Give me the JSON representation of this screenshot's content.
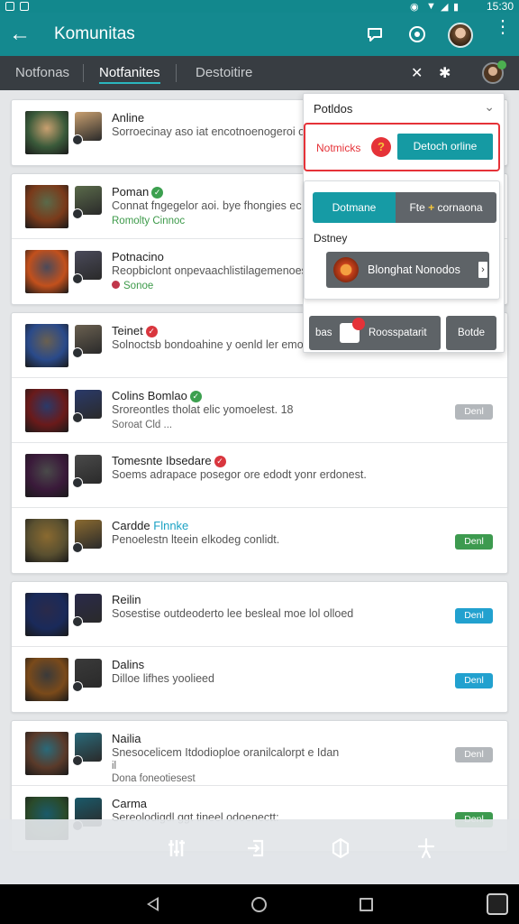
{
  "status": {
    "time": "15:30"
  },
  "appbar": {
    "title": "Komunitas",
    "icons": [
      "back-arrow-icon",
      "chat-icon",
      "target-icon",
      "profile-avatar",
      "more-vert-icon"
    ]
  },
  "tabs": [
    {
      "label": "Notfonas",
      "active": false
    },
    {
      "label": "Notfanites",
      "active": true
    },
    {
      "label": "Destoitire",
      "active": false
    }
  ],
  "groups": [
    {
      "rows": [
        {
          "title": "Anline",
          "desc": "Sorroecinay aso iat encotnoenogeroi odt",
          "sub": "",
          "badge": "",
          "pill": null,
          "colors": [
            "#3a5a3a",
            "#c9a070"
          ]
        }
      ]
    },
    {
      "rows": [
        {
          "title": "Poman",
          "badge": "g",
          "desc": "Connat fngegelor aoi. bye fhongies ec fe",
          "sub": "Romolty Cinnoc",
          "subclass": "green",
          "pill": null,
          "colors": [
            "#7a3a1a",
            "#5a6a4a"
          ]
        },
        {
          "title": "Potnacino",
          "desc": "Reopbiclont onpevaachlistilagemenoes tko",
          "sub": "Sonoe",
          "subclass": "green",
          "subdot": true,
          "pill": null,
          "colors": [
            "#c2501c",
            "#4a4a5a"
          ]
        }
      ]
    },
    {
      "rows": [
        {
          "title": "Teinet",
          "badge": "r",
          "desc": "Solnoctsb bondoahine y oenld ler emoee",
          "sub": "",
          "pill": null,
          "colors": [
            "#2a4a8a",
            "#6a6050"
          ]
        },
        {
          "title": "Colins Bomlao",
          "badge": "g",
          "desc": "Sroreontles tholat elic yomoelest.   18",
          "sub": "Soroat Cld ...",
          "pill": {
            "text": "Denl",
            "color": "#b3b7bb"
          },
          "colors": [
            "#6a1a1a",
            "#2a3a6a"
          ]
        },
        {
          "title": "Tomesnte Ibsedare",
          "badge": "r",
          "desc": "Soems adrapace posegor ore edodt yonr erdonest.",
          "sub": "",
          "pill": null,
          "colors": [
            "#3a1a3a",
            "#4a4a4a"
          ]
        },
        {
          "title": "Cardde",
          "hl": "Flnnke",
          "desc": "Penoelestn lteein elkodeg conlidt.",
          "sub": "",
          "pill": {
            "text": "Denl",
            "color": "#3d9a4f"
          },
          "colors": [
            "#5a5030",
            "#8a6a30"
          ]
        }
      ]
    },
    {
      "rows": [
        {
          "title": "Reilin",
          "desc": "Sosestise outdeoderto lee besleal moe lol olloed",
          "sub": "",
          "pill": {
            "text": "Denl",
            "color": "#22a1cf"
          },
          "colors": [
            "#1a2a5a",
            "#2a2a4a"
          ]
        },
        {
          "title": "Dalins",
          "desc": "Dilloe lifhes yoolieed",
          "sub": "",
          "pill": {
            "text": "Denl",
            "color": "#22a1cf"
          },
          "colors": [
            "#7a4a1a",
            "#3a3a3a"
          ]
        }
      ]
    },
    {
      "rows": [
        {
          "title": "Nailia",
          "desc": "Snesocelicem Itdodioploe oranilcalorpt e Idan",
          "sub": "Dona foneotiesest",
          "sub2": "il",
          "pill": {
            "text": "Denl",
            "color": "#b3b7bb"
          },
          "colors": [
            "#5a3a2a",
            "#2a6a7a"
          ]
        },
        {
          "title": "Carma",
          "desc": "Sereolodigdl ggt tineel odoenectt:",
          "sub": "",
          "pill": {
            "text": "Denl",
            "color": "#3d9a4f"
          },
          "colors": [
            "#2a4a2a",
            "#1a5a6a"
          ]
        }
      ]
    }
  ],
  "panel": {
    "header": "Potldos",
    "notif_label": "Notmicks",
    "notif_button": "Detoch orline",
    "seg_left": "Dotmane",
    "seg_right_prefix": "Fte",
    "seg_right": "cornaona",
    "section_label": "Dstney",
    "big_button": "Blonghat Nonodos",
    "bottom_left_prefix": "bas",
    "bottom_left": "Roosspatarit",
    "bottom_right": "Botde"
  },
  "bottom_toolbar_icons": [
    "sliders-icon",
    "export-icon",
    "box-icon",
    "pin-icon"
  ],
  "nav_icons": [
    "nav-back-icon",
    "nav-home-icon",
    "nav-recents-icon",
    "keyboard-icon"
  ]
}
